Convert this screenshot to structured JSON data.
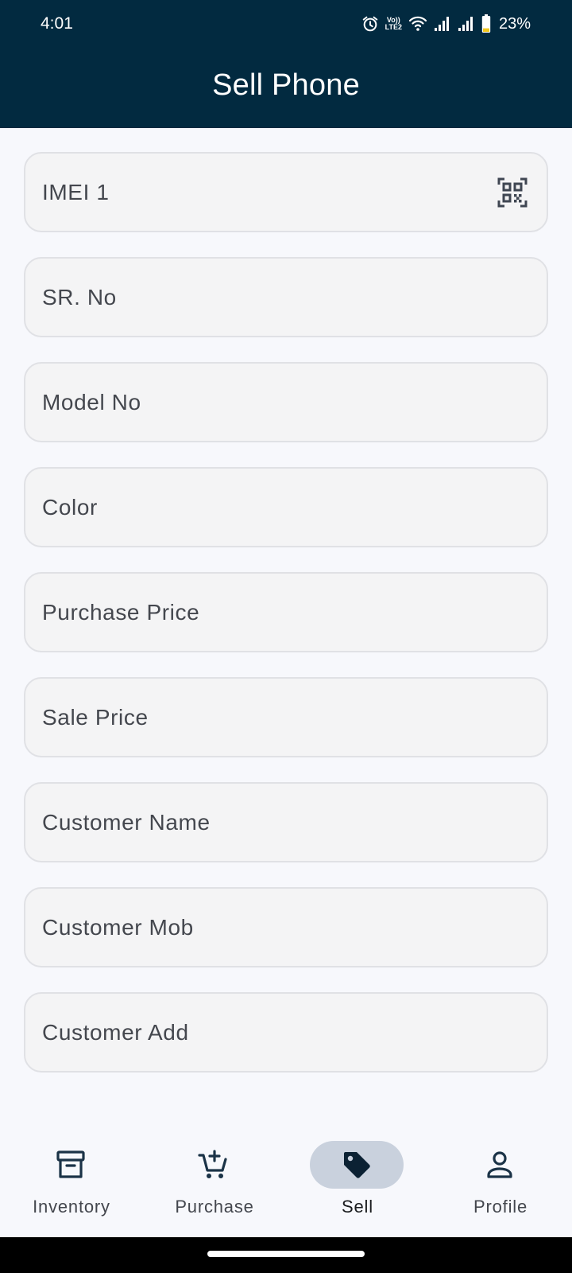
{
  "status_bar": {
    "time": "4:01",
    "network_badge_top": "Vo))",
    "network_badge_bottom": "LTE2",
    "battery_text": "23%",
    "battery_level": 0.23,
    "icons": [
      "alarm-icon",
      "volte-icon",
      "wifi-icon",
      "signal-icon",
      "signal-icon",
      "battery-icon"
    ]
  },
  "app_bar": {
    "title": "Sell Phone"
  },
  "form": {
    "fields": [
      {
        "label": "IMEI 1",
        "trailing_icon": "qr-scan-icon"
      },
      {
        "label": "SR. No"
      },
      {
        "label": "Model No"
      },
      {
        "label": "Color"
      },
      {
        "label": "Purchase Price"
      },
      {
        "label": "Sale Price"
      },
      {
        "label": "Customer Name"
      },
      {
        "label": "Customer Mob"
      },
      {
        "label": "Customer Add"
      }
    ]
  },
  "bottom_nav": {
    "items": [
      {
        "label": "Inventory",
        "icon": "archive-box-icon",
        "selected": false
      },
      {
        "label": "Purchase",
        "icon": "cart-add-icon",
        "selected": false
      },
      {
        "label": "Sell",
        "icon": "tag-icon",
        "selected": true
      },
      {
        "label": "Profile",
        "icon": "person-icon",
        "selected": false
      }
    ]
  },
  "colors": {
    "app_bar": "#022a40",
    "background": "#f7f8fc",
    "field_fill": "#f4f4f5",
    "field_border": "#e0e1e5",
    "nav_active_pill": "#c9d1dd",
    "icon_dark": "#1b3347",
    "battery_fill": "#f2c81d"
  }
}
